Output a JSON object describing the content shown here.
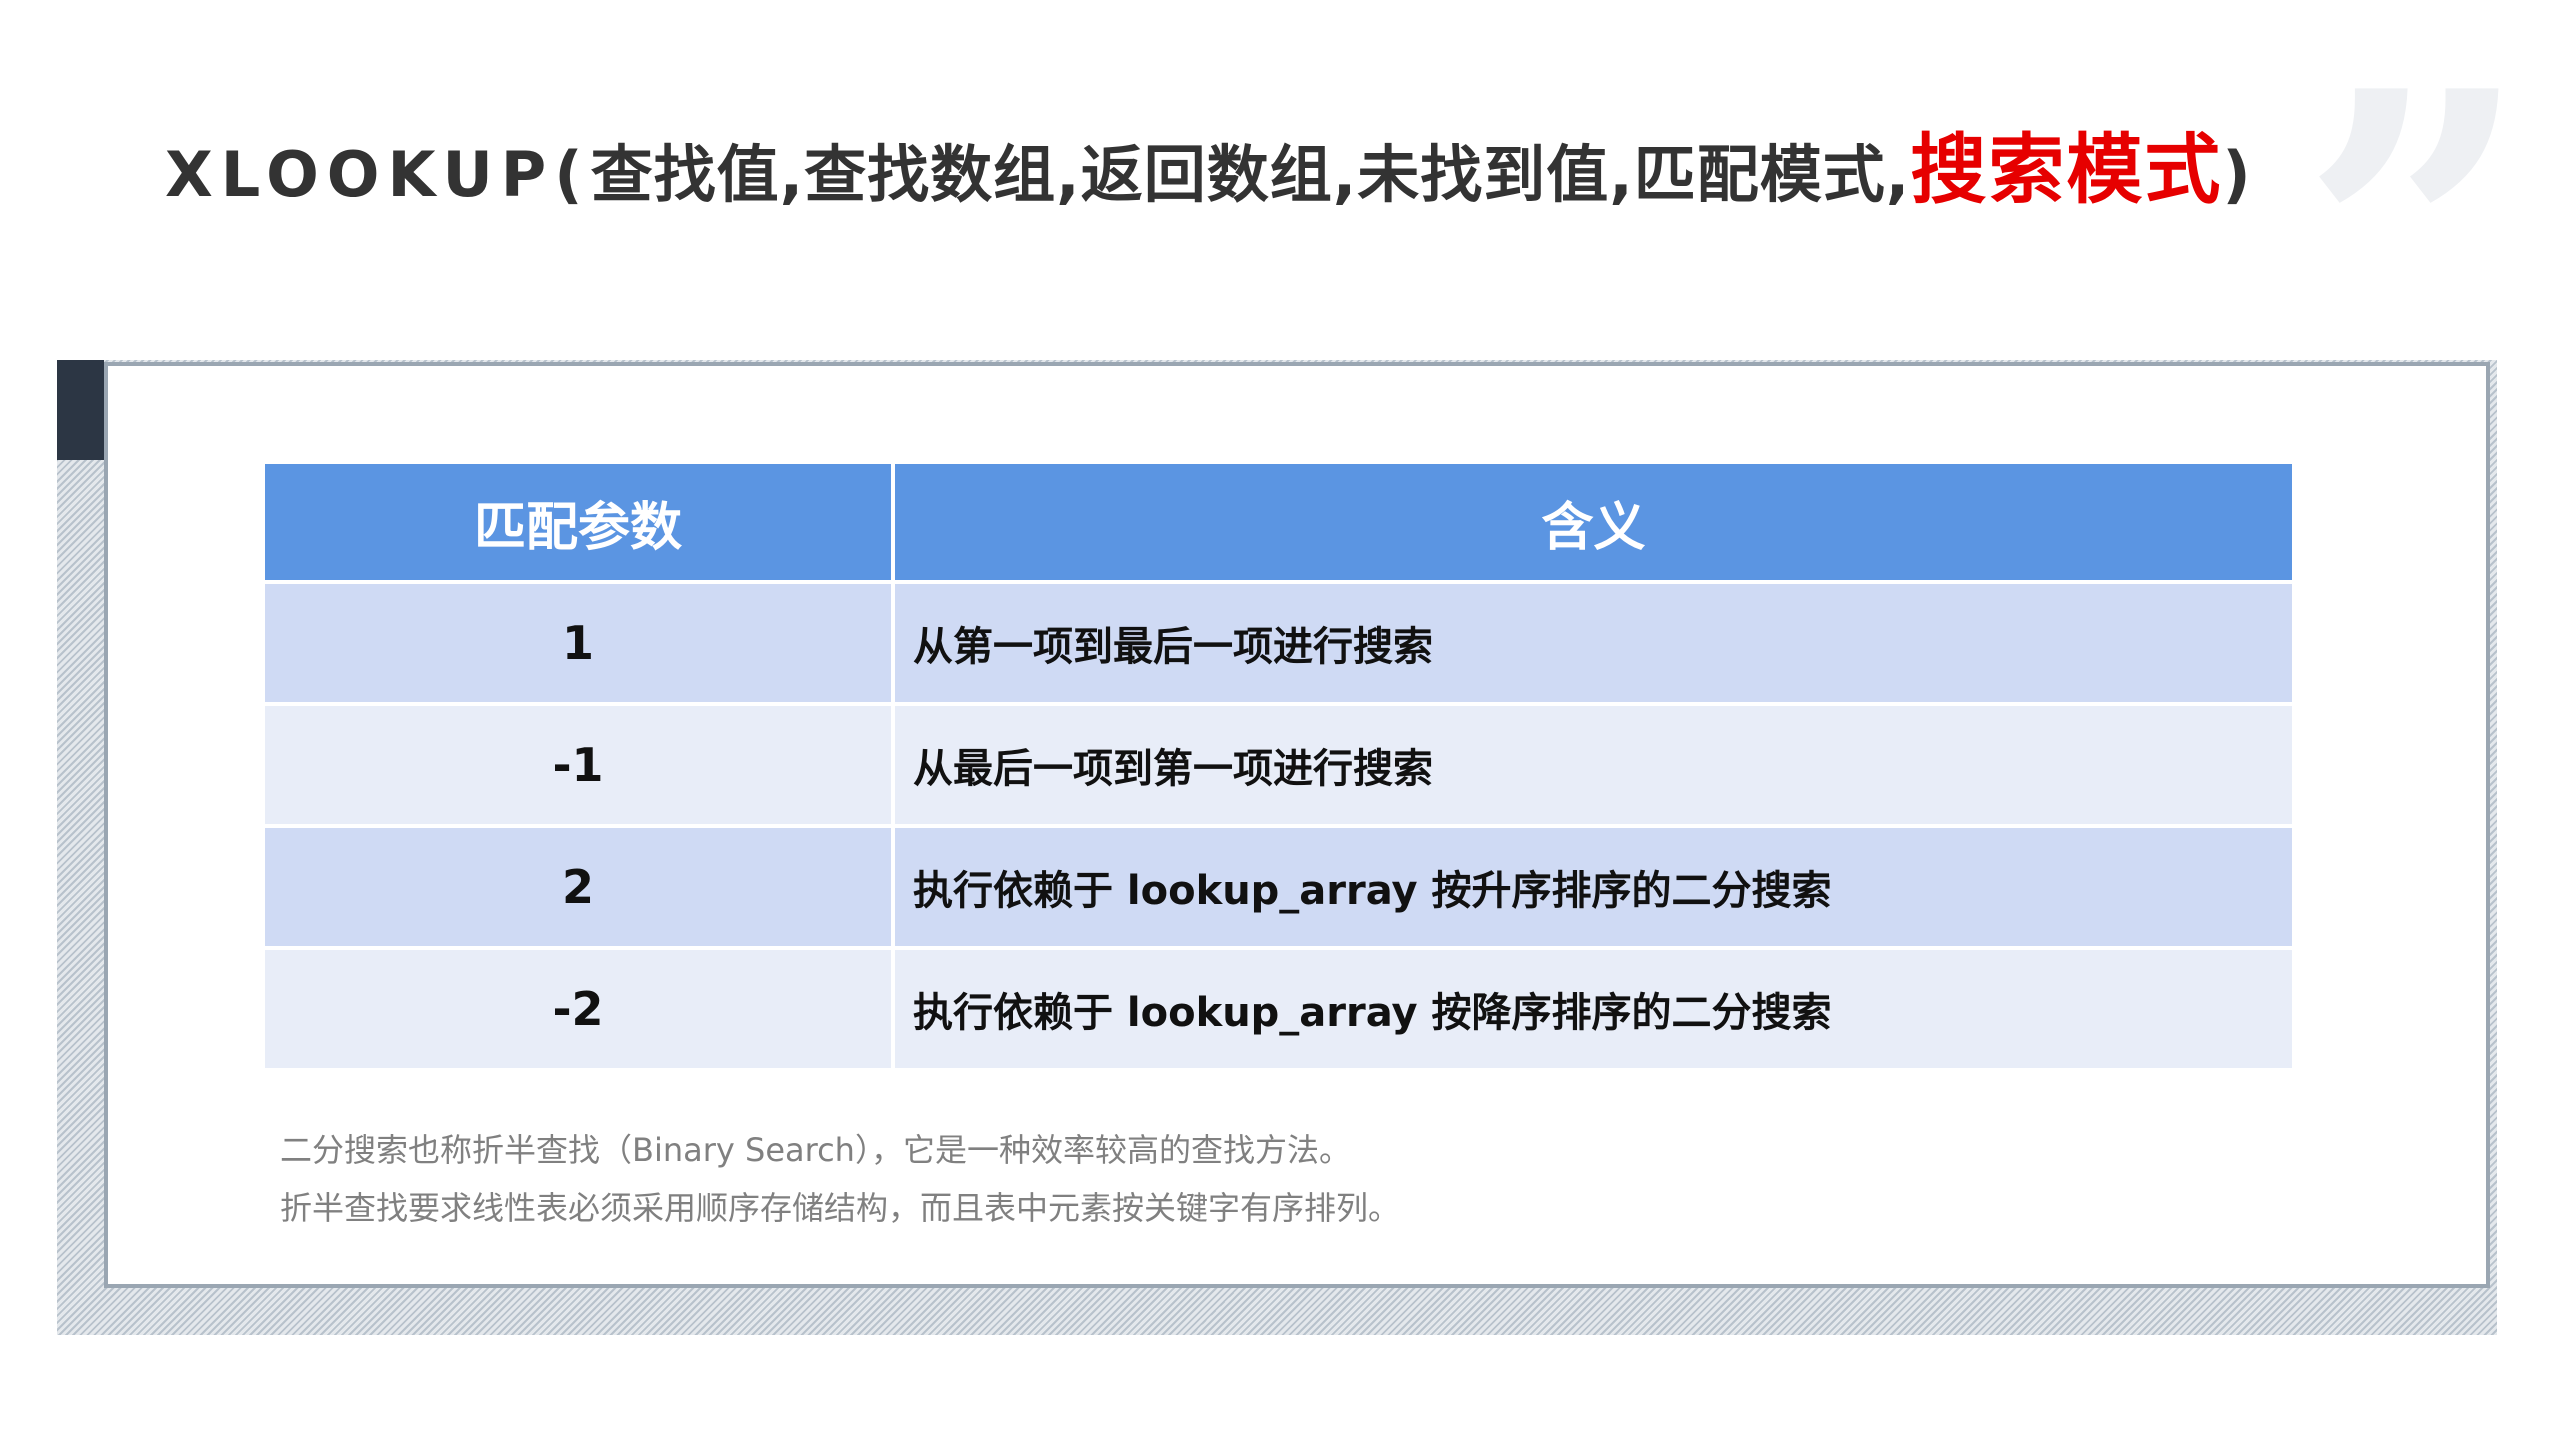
{
  "title": {
    "func_open": "XLOOKUP(",
    "args_regular": "查找值,查找数组,返回数组,未找到值,匹配模式,",
    "arg_highlight": "搜索模式",
    "close": ")",
    "highlight_color": "#e60000"
  },
  "decor": {
    "quote_mark": "”"
  },
  "table": {
    "headers": [
      "匹配参数",
      "含义"
    ],
    "rows": [
      {
        "param": "1",
        "meaning": "从第一项到最后一项进行搜索"
      },
      {
        "param": "-1",
        "meaning": "从最后一项到第一项进行搜索"
      },
      {
        "param": "2",
        "meaning": "执行依赖于 lookup_array 按升序排序的二分搜索"
      },
      {
        "param": "-2",
        "meaning": "执行依赖于 lookup_array 按降序排序的二分搜索"
      }
    ],
    "header_color": "#5b95e2"
  },
  "notes": {
    "line1": "二分搜索也称折半查找（Binary Search），它是一种效率较高的查找方法。",
    "line2": "折半查找要求线性表必须采用顺序存储结构，而且表中元素按关键字有序排列。"
  }
}
